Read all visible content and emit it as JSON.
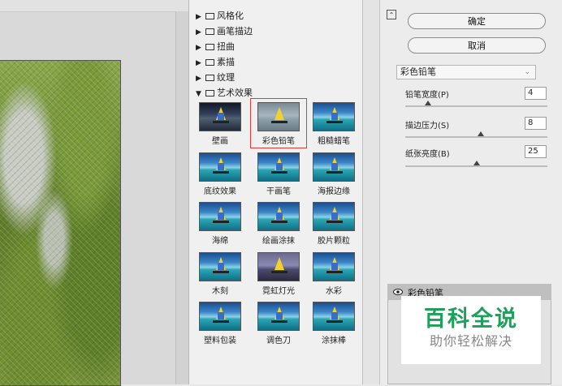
{
  "gallery": {
    "categories": [
      {
        "label": "风格化",
        "expanded": false
      },
      {
        "label": "画笔描边",
        "expanded": false
      },
      {
        "label": "扭曲",
        "expanded": false
      },
      {
        "label": "素描",
        "expanded": false
      },
      {
        "label": "纹理",
        "expanded": false
      },
      {
        "label": "艺术效果",
        "expanded": true
      }
    ],
    "filters": [
      {
        "label": "壁画"
      },
      {
        "label": "彩色铅笔"
      },
      {
        "label": "粗糙蜡笔"
      },
      {
        "label": "底纹效果"
      },
      {
        "label": "干画笔"
      },
      {
        "label": "海报边缘"
      },
      {
        "label": "海绵"
      },
      {
        "label": "绘画涂抹"
      },
      {
        "label": "胶片颗粒"
      },
      {
        "label": "木刻"
      },
      {
        "label": "霓虹灯光"
      },
      {
        "label": "水彩"
      },
      {
        "label": "塑料包装"
      },
      {
        "label": "调色刀"
      },
      {
        "label": "涂抹棒"
      }
    ],
    "selected_filter": "彩色铅笔"
  },
  "settings": {
    "ok_label": "确定",
    "cancel_label": "取消",
    "selected_filter": "彩色铅笔",
    "params": [
      {
        "label": "铅笔宽度(P)",
        "value": "4",
        "fraction": 0.16
      },
      {
        "label": "描边压力(S)",
        "value": "8",
        "fraction": 0.53
      },
      {
        "label": "纸张亮度(B)",
        "value": "25",
        "fraction": 0.5
      }
    ]
  },
  "layers": {
    "items": [
      {
        "name": "彩色铅笔",
        "visible": true
      }
    ]
  },
  "watermark": {
    "title": "百科全说",
    "subtitle": "助你轻松解决"
  }
}
